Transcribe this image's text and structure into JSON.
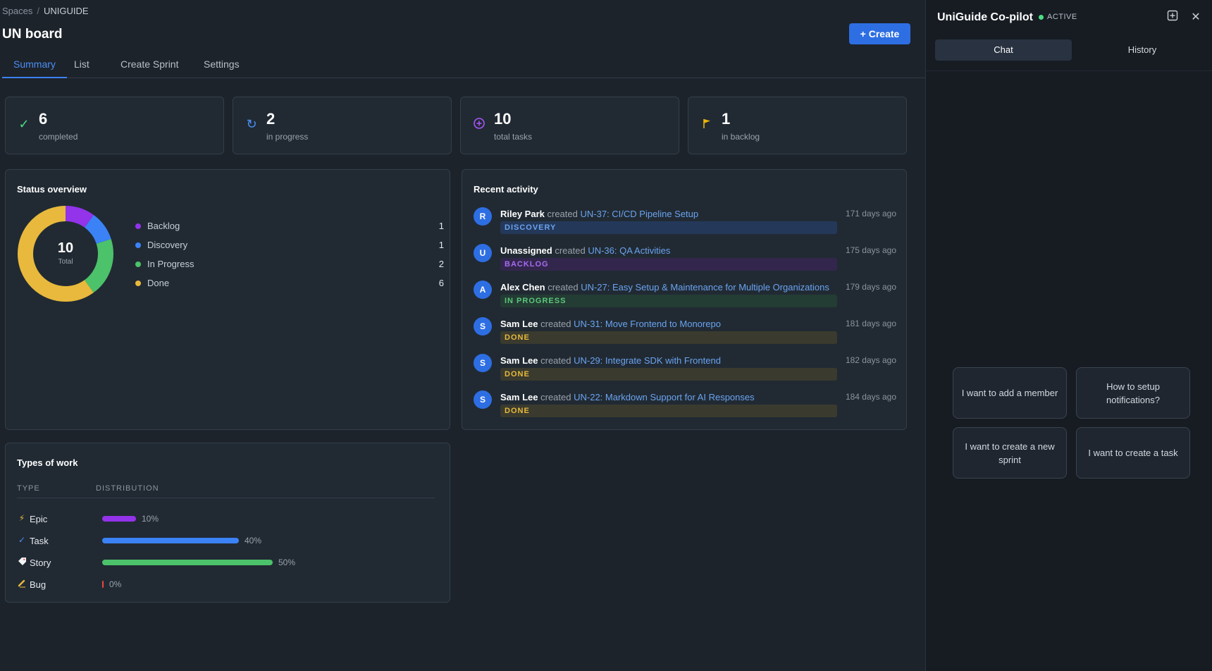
{
  "breadcrumb": {
    "root": "Spaces",
    "separator": "/",
    "current": "UNIGUIDE"
  },
  "page": {
    "title": "UN board",
    "create_label": "+ Create"
  },
  "tabs": [
    {
      "label": "Summary",
      "active": true
    },
    {
      "label": "List"
    },
    {
      "label": "Create Sprint"
    },
    {
      "label": "Settings"
    }
  ],
  "stats": [
    {
      "value": "6",
      "label": "completed",
      "icon": "check-icon",
      "color": "#4ade80"
    },
    {
      "value": "2",
      "label": "in progress",
      "icon": "refresh-icon",
      "color": "#4a8ff5"
    },
    {
      "value": "10",
      "label": "total tasks",
      "icon": "plus-circle-icon",
      "color": "#a855f7"
    },
    {
      "value": "1",
      "label": "in backlog",
      "icon": "flag-icon",
      "color": "#eab308"
    }
  ],
  "status_overview": {
    "title": "Status overview",
    "total_value": "10",
    "total_label": "Total",
    "items": [
      {
        "label": "Backlog",
        "count": 1,
        "color": "#9333ea"
      },
      {
        "label": "Discovery",
        "count": 1,
        "color": "#3b82f6"
      },
      {
        "label": "In Progress",
        "count": 2,
        "color": "#4cc26a"
      },
      {
        "label": "Done",
        "count": 6,
        "color": "#e8b93c"
      }
    ]
  },
  "recent_activity": {
    "title": "Recent activity",
    "items": [
      {
        "avatar": "R",
        "user": "Riley Park",
        "verb": "created",
        "link": "UN-37: CI/CD Pipeline Setup",
        "badge": "DISCOVERY",
        "time": "171 days ago"
      },
      {
        "avatar": "U",
        "user": "Unassigned",
        "verb": "created",
        "link": "UN-36: QA Activities",
        "badge": "BACKLOG",
        "time": "175 days ago"
      },
      {
        "avatar": "A",
        "user": "Alex Chen",
        "verb": "created",
        "link": "UN-27: Easy Setup & Maintenance for Multiple Organizations",
        "badge": "IN PROGRESS",
        "time": "179 days ago"
      },
      {
        "avatar": "S",
        "user": "Sam Lee",
        "verb": "created",
        "link": "UN-31: Move Frontend to Monorepo",
        "badge": "DONE",
        "time": "181 days ago"
      },
      {
        "avatar": "S",
        "user": "Sam Lee",
        "verb": "created",
        "link": "UN-29: Integrate SDK with Frontend",
        "badge": "DONE",
        "time": "182 days ago"
      },
      {
        "avatar": "S",
        "user": "Sam Lee",
        "verb": "created",
        "link": "UN-22: Markdown Support for AI Responses",
        "badge": "DONE",
        "time": "184 days ago"
      }
    ]
  },
  "types_of_work": {
    "title": "Types of work",
    "col_type": "TYPE",
    "col_distribution": "DISTRIBUTION",
    "items": [
      {
        "icon": "lightning-icon",
        "label": "Epic",
        "percent": 10,
        "percent_label": "10%",
        "color": "#9333ea"
      },
      {
        "icon": "check-icon",
        "label": "Task",
        "percent": 40,
        "percent_label": "40%",
        "color": "#3b82f6"
      },
      {
        "icon": "tag-icon",
        "label": "Story",
        "percent": 50,
        "percent_label": "50%",
        "color": "#4cc26a"
      },
      {
        "icon": "bug-icon",
        "label": "Bug",
        "percent": 0,
        "percent_label": "0%",
        "color": "#ef4444"
      }
    ]
  },
  "copilot": {
    "title": "UniGuide Co-pilot",
    "status": "ACTIVE",
    "tabs": [
      {
        "label": "Chat",
        "active": true
      },
      {
        "label": "History"
      }
    ],
    "suggestions": [
      "I want to add a member",
      "How to setup notifications?",
      "I want to create a new sprint",
      "I want to create a task"
    ]
  }
}
